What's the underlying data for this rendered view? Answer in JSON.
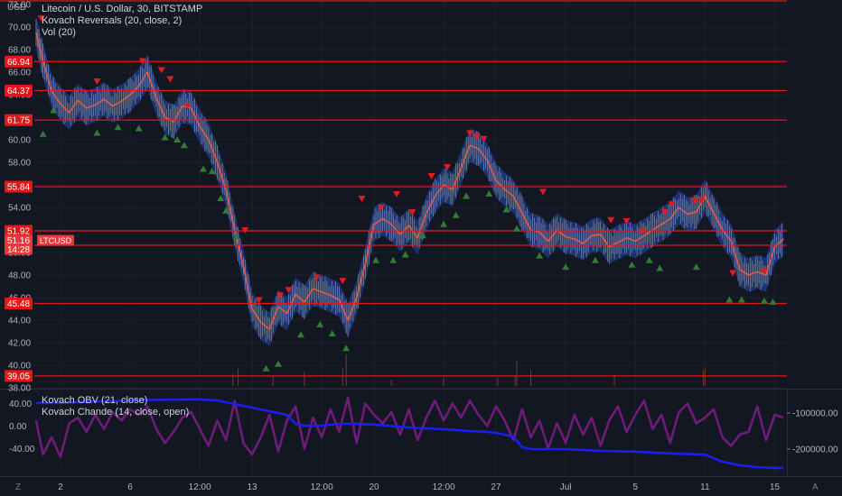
{
  "header": {
    "currency_label": "USD",
    "title": "Litecoin / U.S. Dollar, 30, BITSTAMP",
    "indicator1": "Kovach Reversals (20, close, 2)",
    "indicator2": "Vol (20)"
  },
  "sub_pane": {
    "indicator1": "Kovach OBV (21, close)",
    "indicator2": "Kovach Chande (14, close, open)",
    "left_ticks": [
      "40.00",
      "0.00",
      "-40.00"
    ],
    "left_tick_values": [
      40,
      0,
      -40
    ],
    "right_ticks": [
      "-100000.00",
      "-200000.00"
    ],
    "right_tick_values": [
      -100000,
      -200000
    ]
  },
  "footer": {
    "left_icon": "Z",
    "right_icon": "A"
  },
  "colors": {
    "background": "#131722",
    "level_line": "#e6151a",
    "price_line": "#e05a47",
    "band": "#1f3e8c",
    "obv": "#1a1ff0",
    "chande": "#6e1b7a",
    "up_marker": "#2e7d32",
    "down_marker": "#e51a1a"
  },
  "chart_data": {
    "type": "line",
    "title": "Litecoin / U.S. Dollar, 30, BITSTAMP",
    "xlabel": "",
    "ylabel": "USD",
    "ylim": [
      38,
      72.4
    ],
    "grid": true,
    "y_ticks": [
      38,
      40,
      42,
      44,
      46,
      48,
      50,
      52,
      54,
      56,
      58,
      60,
      62,
      64,
      66,
      68,
      70,
      72
    ],
    "y_tick_labels": [
      "38.00",
      "40.00",
      "42.00",
      "44.00",
      "46.00",
      "48.00",
      "50.00",
      "52.00",
      "54.00",
      "56.00",
      "58.00",
      "60.00",
      "62.00",
      "64.00",
      "66.00",
      "68.00",
      "70.00",
      "72.00"
    ],
    "x_tick_labels": [
      "2",
      "6",
      "12:00",
      "13",
      "12:00",
      "20",
      "12:00",
      "27",
      "Jul",
      "5",
      "11",
      "15"
    ],
    "x_tick_positions": [
      2,
      6,
      10,
      13,
      17,
      20,
      24,
      27,
      31,
      35,
      39,
      43
    ],
    "x_range": [
      0.5,
      43.7
    ],
    "levels": [
      {
        "label": "66.94",
        "value": 66.94
      },
      {
        "label": "64.37",
        "value": 64.37
      },
      {
        "label": "61.75",
        "value": 61.75
      },
      {
        "label": "55.84",
        "value": 55.84
      },
      {
        "label": "51.92",
        "value": 51.92
      },
      {
        "label": "50.64",
        "value": 50.64
      },
      {
        "label": "45.48",
        "value": 45.48
      },
      {
        "label": "39.05",
        "value": 39.05
      }
    ],
    "top_level": 72.4,
    "current_price": {
      "label": "51.16",
      "value": 51.16,
      "countdown": "14:28",
      "symbol": "LTCUSD"
    },
    "series": [
      {
        "name": "LTCUSD",
        "x": [
          0.6,
          1.0,
          1.5,
          2.0,
          2.5,
          3.0,
          3.5,
          4.0,
          4.5,
          5.0,
          5.5,
          6.0,
          6.5,
          7.0,
          7.5,
          8.0,
          8.5,
          9.0,
          9.5,
          10.0,
          10.5,
          11.0,
          11.5,
          12.0,
          12.5,
          13.0,
          13.5,
          14.0,
          14.5,
          15.0,
          15.5,
          16.0,
          16.5,
          17.0,
          17.5,
          18.0,
          18.5,
          19.0,
          19.5,
          20.0,
          20.5,
          21.0,
          21.5,
          22.0,
          22.5,
          23.0,
          23.5,
          24.0,
          24.5,
          25.0,
          25.5,
          26.0,
          26.5,
          27.0,
          27.5,
          28.0,
          28.5,
          29.0,
          29.5,
          30.0,
          30.5,
          31.0,
          31.5,
          32.0,
          32.5,
          33.0,
          33.5,
          34.0,
          34.5,
          35.0,
          35.5,
          36.0,
          36.5,
          37.0,
          37.5,
          38.0,
          38.5,
          39.0,
          39.5,
          40.0,
          40.5,
          41.0,
          41.5,
          42.0,
          42.5,
          43.0,
          43.5
        ],
        "values": [
          69.5,
          67.0,
          64.3,
          63.2,
          62.4,
          63.5,
          62.8,
          63.1,
          63.6,
          63.0,
          63.4,
          64.0,
          64.8,
          66.0,
          63.7,
          62.0,
          61.6,
          63.0,
          62.8,
          61.2,
          60.0,
          58.0,
          55.6,
          52.0,
          48.8,
          45.0,
          43.8,
          43.2,
          45.2,
          44.6,
          46.3,
          45.6,
          46.8,
          46.5,
          46.2,
          45.8,
          44.0,
          46.0,
          49.0,
          52.5,
          53.0,
          52.5,
          51.6,
          52.4,
          51.3,
          53.5,
          55.0,
          56.0,
          55.6,
          57.5,
          59.5,
          59.2,
          58.2,
          56.4,
          55.6,
          55.0,
          53.5,
          52.0,
          51.8,
          51.0,
          52.0,
          51.4,
          51.2,
          50.8,
          51.5,
          51.6,
          50.5,
          50.9,
          51.3,
          51.0,
          51.5,
          52.0,
          52.5,
          53.0,
          54.0,
          53.4,
          53.6,
          55.0,
          53.5,
          52.0,
          51.0,
          48.5,
          48.0,
          48.3,
          48.0,
          50.5,
          51.2
        ]
      }
    ],
    "band_width": 1.5,
    "reversal_down_markers": [
      [
        0.9,
        70.8
      ],
      [
        4.1,
        65.2
      ],
      [
        6.7,
        67.0
      ],
      [
        7.8,
        66.2
      ],
      [
        8.3,
        65.4
      ],
      [
        9.3,
        63.0
      ],
      [
        12.6,
        52.0
      ],
      [
        13.4,
        45.8
      ],
      [
        14.6,
        46.2
      ],
      [
        15.1,
        46.7
      ],
      [
        16.7,
        47.8
      ],
      [
        18.2,
        47.5
      ],
      [
        19.3,
        54.8
      ],
      [
        20.4,
        54.0
      ],
      [
        21.3,
        55.2
      ],
      [
        22.2,
        53.6
      ],
      [
        23.3,
        56.8
      ],
      [
        24.2,
        57.6
      ],
      [
        25.5,
        60.6
      ],
      [
        25.9,
        60.3
      ],
      [
        26.3,
        60.1
      ],
      [
        29.7,
        55.4
      ],
      [
        33.6,
        52.9
      ],
      [
        34.5,
        52.8
      ],
      [
        35.4,
        51.9
      ],
      [
        36.7,
        53.6
      ],
      [
        37.1,
        54.3
      ],
      [
        38.4,
        54.6
      ],
      [
        38.8,
        54.7
      ],
      [
        40.6,
        48.2
      ],
      [
        42.4,
        48.4
      ]
    ],
    "reversal_up_markers": [
      [
        1.0,
        60.5
      ],
      [
        1.6,
        62.6
      ],
      [
        4.1,
        60.6
      ],
      [
        5.3,
        61.1
      ],
      [
        6.5,
        61.0
      ],
      [
        8.0,
        60.2
      ],
      [
        8.7,
        60.0
      ],
      [
        9.1,
        59.5
      ],
      [
        10.2,
        57.4
      ],
      [
        10.7,
        57.2
      ],
      [
        11.2,
        54.8
      ],
      [
        11.5,
        53.7
      ],
      [
        12.1,
        51.4
      ],
      [
        13.8,
        39.7
      ],
      [
        14.5,
        40.1
      ],
      [
        15.8,
        42.7
      ],
      [
        16.9,
        43.6
      ],
      [
        17.6,
        42.8
      ],
      [
        18.4,
        41.5
      ],
      [
        20.1,
        49.3
      ],
      [
        21.1,
        49.3
      ],
      [
        21.8,
        49.8
      ],
      [
        22.8,
        51.5
      ],
      [
        24.0,
        52.5
      ],
      [
        24.7,
        53.3
      ],
      [
        25.3,
        55.0
      ],
      [
        26.6,
        55.2
      ],
      [
        27.6,
        53.8
      ],
      [
        28.2,
        52.1
      ],
      [
        29.5,
        49.7
      ],
      [
        31.0,
        48.7
      ],
      [
        32.7,
        49.3
      ],
      [
        34.8,
        48.9
      ],
      [
        35.8,
        49.3
      ],
      [
        36.4,
        48.6
      ],
      [
        38.5,
        48.7
      ],
      [
        40.4,
        45.8
      ],
      [
        41.1,
        45.8
      ],
      [
        42.4,
        45.7
      ],
      [
        42.9,
        45.6
      ]
    ],
    "volume_spikes": [
      [
        11.9,
        0.6
      ],
      [
        12.2,
        0.9
      ],
      [
        14.2,
        0.5
      ],
      [
        16.0,
        0.7
      ],
      [
        18.2,
        0.9
      ],
      [
        18.4,
        1.6
      ],
      [
        21.0,
        0.3
      ],
      [
        24.0,
        0.4
      ],
      [
        27.1,
        0.4
      ],
      [
        28.1,
        0.5
      ],
      [
        28.2,
        1.3
      ],
      [
        29.0,
        0.8
      ],
      [
        33.8,
        0.6
      ],
      [
        38.9,
        0.8
      ],
      [
        39.0,
        0.9
      ]
    ],
    "obv": {
      "name": "Kovach OBV (21, close)",
      "unit_range": [
        -250000,
        -50000
      ],
      "x": [
        0.6,
        2.0,
        4.0,
        6.0,
        8.0,
        10.0,
        11.0,
        12.0,
        13.0,
        14.0,
        15.0,
        15.5,
        16.0,
        17.0,
        18.0,
        19.0,
        20.0,
        22.0,
        24.0,
        25.5,
        26.5,
        27.0,
        28.0,
        28.5,
        29.0,
        31.0,
        33.0,
        35.0,
        37.0,
        39.0,
        40.0,
        41.0,
        42.0,
        43.0,
        43.5
      ],
      "values": [
        -72000,
        -72000,
        -68000,
        -65000,
        -63000,
        -62000,
        -65000,
        -75000,
        -85000,
        -95000,
        -105000,
        -130000,
        -135000,
        -135000,
        -130000,
        -130000,
        -132000,
        -140000,
        -145000,
        -150000,
        -152000,
        -155000,
        -165000,
        -195000,
        -200000,
        -200000,
        -205000,
        -207000,
        -212000,
        -215000,
        -235000,
        -245000,
        -250000,
        -252000,
        -253000
      ]
    },
    "chande": {
      "name": "Kovach Chande (14, close, open)",
      "ylim": [
        -60,
        60
      ],
      "x": [
        0.6,
        1.0,
        1.5,
        2.0,
        2.5,
        3.0,
        3.5,
        4.0,
        4.5,
        5.0,
        5.5,
        6.0,
        6.5,
        7.0,
        7.5,
        8.0,
        8.5,
        9.0,
        9.5,
        10.0,
        10.5,
        11.0,
        11.5,
        12.0,
        12.5,
        13.0,
        13.5,
        14.0,
        14.5,
        15.0,
        15.5,
        16.0,
        16.5,
        17.0,
        17.5,
        18.0,
        18.5,
        19.0,
        19.5,
        20.0,
        20.5,
        21.0,
        21.5,
        22.0,
        22.5,
        23.0,
        23.5,
        24.0,
        24.5,
        25.0,
        25.5,
        26.0,
        26.5,
        27.0,
        27.5,
        28.0,
        28.5,
        29.0,
        29.5,
        30.0,
        30.5,
        31.0,
        31.5,
        32.0,
        32.5,
        33.0,
        33.5,
        34.0,
        34.5,
        35.0,
        35.5,
        36.0,
        36.5,
        37.0,
        37.5,
        38.0,
        38.5,
        39.0,
        39.5,
        40.0,
        40.5,
        41.0,
        41.5,
        42.0,
        42.5,
        43.0,
        43.5
      ],
      "values": [
        10,
        -50,
        -20,
        -55,
        5,
        15,
        -10,
        20,
        -5,
        25,
        10,
        30,
        20,
        35,
        -5,
        -30,
        -10,
        15,
        25,
        -5,
        -35,
        10,
        -25,
        45,
        -30,
        -50,
        -20,
        20,
        -45,
        10,
        35,
        -40,
        15,
        -20,
        30,
        -10,
        50,
        -30,
        40,
        20,
        5,
        25,
        -15,
        30,
        -25,
        15,
        45,
        10,
        40,
        15,
        45,
        20,
        0,
        35,
        10,
        -25,
        30,
        -20,
        10,
        -40,
        5,
        -30,
        20,
        -15,
        15,
        -35,
        10,
        35,
        -10,
        20,
        45,
        -5,
        20,
        -30,
        25,
        40,
        5,
        15,
        30,
        -20,
        -35,
        -15,
        -10,
        35,
        -25,
        20,
        15
      ]
    }
  }
}
